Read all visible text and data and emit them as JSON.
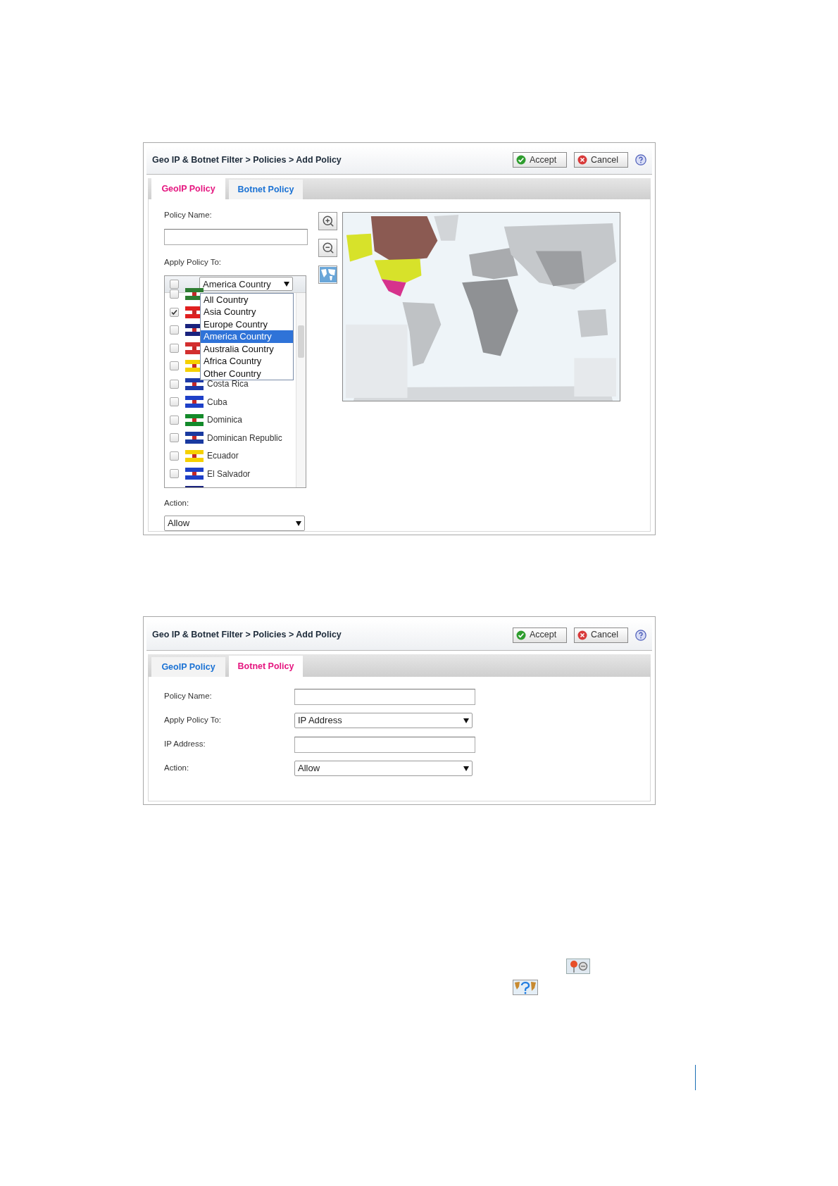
{
  "panels": [
    {
      "kind": "geoip",
      "breadcrumb": "Geo IP & Botnet Filter > Policies > Add Policy",
      "buttons": [
        {
          "kind": "accept",
          "label": "Accept"
        },
        {
          "kind": "cancel",
          "label": "Cancel"
        }
      ],
      "tabs": [
        {
          "label": "GeoIP Policy",
          "selected": true
        },
        {
          "label": "Botnet Policy",
          "selected": false
        }
      ],
      "policy_name_label": "Policy Name:",
      "apply_label": "Apply Policy To:",
      "country_list": {
        "all_checked": false,
        "dropdown": {
          "value": "America Country",
          "options": [
            {
              "label": "All Country",
              "selected": false
            },
            {
              "label": "Asia Country",
              "selected": false
            },
            {
              "label": "Europe Country",
              "selected": false
            },
            {
              "label": "America Country",
              "selected": true
            },
            {
              "label": "Australia Country",
              "selected": false
            },
            {
              "label": "Africa Country",
              "selected": false
            },
            {
              "label": "Other Country",
              "selected": false
            }
          ]
        },
        "rows": [
          {
            "checked": false,
            "color": "#2e7d32"
          },
          {
            "checked": true,
            "color": "#e02020"
          },
          {
            "checked": false,
            "color": "#1a237e"
          },
          {
            "checked": false,
            "color": "#d32f2f"
          },
          {
            "checked": false,
            "color": "#f5d000"
          },
          {
            "name": "Costa Rica",
            "checked": false,
            "color": "#1e3aa8"
          },
          {
            "name": "Cuba",
            "checked": false,
            "color": "#1e40c8"
          },
          {
            "name": "Dominica",
            "checked": false,
            "color": "#138a2a"
          },
          {
            "name": "Dominican Republic",
            "checked": false,
            "color": "#1a3aa0"
          },
          {
            "name": "Ecuador",
            "checked": false,
            "color": "#f5d000"
          },
          {
            "name": "El Salvador",
            "checked": false,
            "color": "#1e40c8"
          },
          {
            "color": "#1a237e"
          }
        ]
      },
      "action": {
        "label": "Action:",
        "value": "Allow"
      }
    },
    {
      "kind": "botnet",
      "breadcrumb": "Geo IP & Botnet Filter > Policies > Add Policy",
      "buttons": [
        {
          "kind": "accept",
          "label": "Accept"
        },
        {
          "kind": "cancel",
          "label": "Cancel"
        }
      ],
      "tabs": [
        {
          "label": "GeoIP Policy",
          "selected": false
        },
        {
          "label": "Botnet Policy",
          "selected": true
        }
      ],
      "fields": [
        {
          "kind": "input",
          "label": "Policy Name:"
        },
        {
          "kind": "select",
          "label": "Apply Policy To:",
          "value": "IP Address"
        },
        {
          "kind": "input",
          "label": "IP Address:"
        },
        {
          "kind": "select",
          "label": "Action:",
          "value": "Allow"
        }
      ]
    }
  ]
}
